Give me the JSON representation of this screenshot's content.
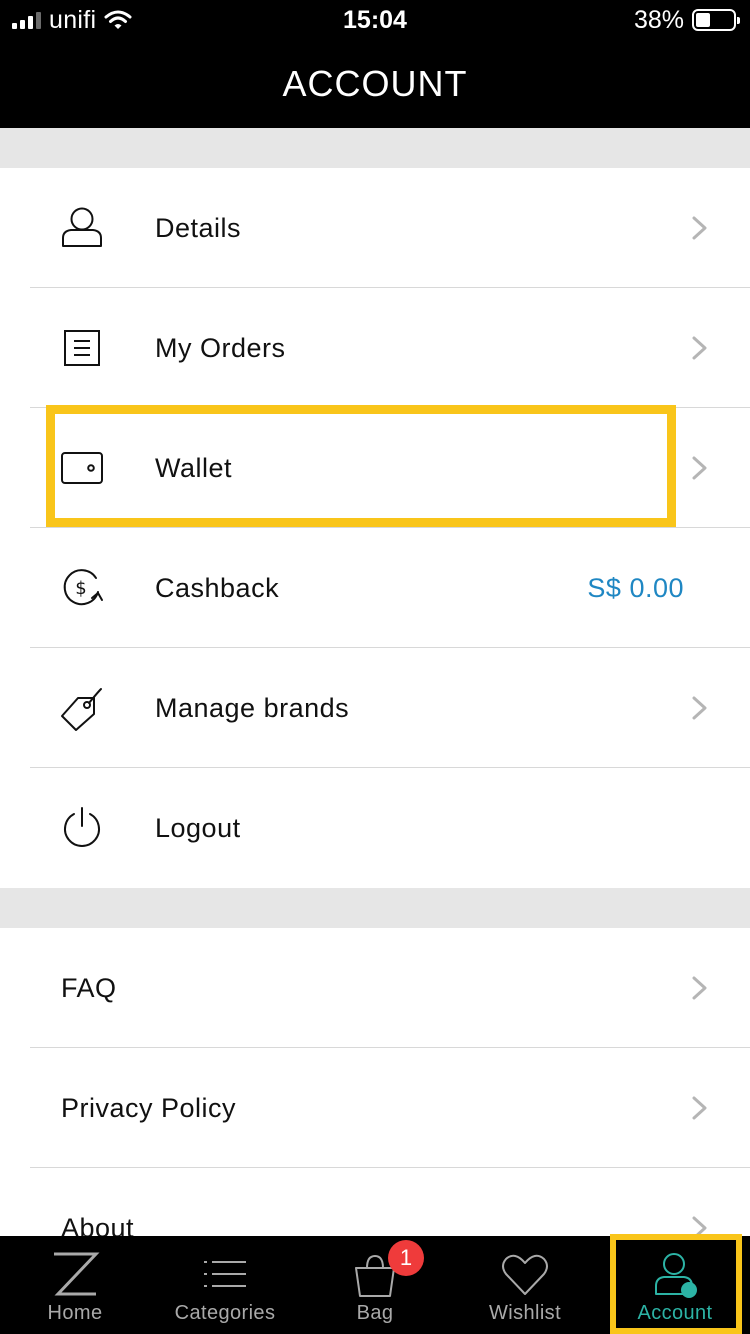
{
  "status_bar": {
    "carrier": "unifi",
    "time": "15:04",
    "battery_percent_label": "38%",
    "battery_level": 0.38
  },
  "header": {
    "title": "ACCOUNT"
  },
  "menu_section_1": [
    {
      "label": "Details",
      "icon": "user-icon",
      "has_chevron": true
    },
    {
      "label": "My Orders",
      "icon": "orders-icon",
      "has_chevron": true
    },
    {
      "label": "Wallet",
      "icon": "wallet-icon",
      "has_chevron": true,
      "highlighted": true
    },
    {
      "label": "Cashback",
      "icon": "cashback-icon",
      "value": "S$ 0.00"
    },
    {
      "label": "Manage brands",
      "icon": "tag-icon",
      "has_chevron": true
    },
    {
      "label": "Logout",
      "icon": "power-icon"
    }
  ],
  "menu_section_2": [
    {
      "label": "FAQ",
      "has_chevron": true
    },
    {
      "label": "Privacy Policy",
      "has_chevron": true
    },
    {
      "label": "About",
      "has_chevron": true
    }
  ],
  "tab_bar": {
    "tabs": [
      {
        "label": "Home",
        "icon": "z-logo-icon"
      },
      {
        "label": "Categories",
        "icon": "list-icon"
      },
      {
        "label": "Bag",
        "icon": "bag-icon",
        "badge": "1"
      },
      {
        "label": "Wishlist",
        "icon": "heart-icon"
      },
      {
        "label": "Account",
        "icon": "account-icon",
        "active": true
      }
    ]
  },
  "colors": {
    "accent_teal": "#2cb3a5",
    "value_blue": "#1f87c3",
    "highlight_yellow": "#f9c51a",
    "badge_red": "#ef3b3b",
    "section_gap_gray": "#e6e6e6"
  }
}
